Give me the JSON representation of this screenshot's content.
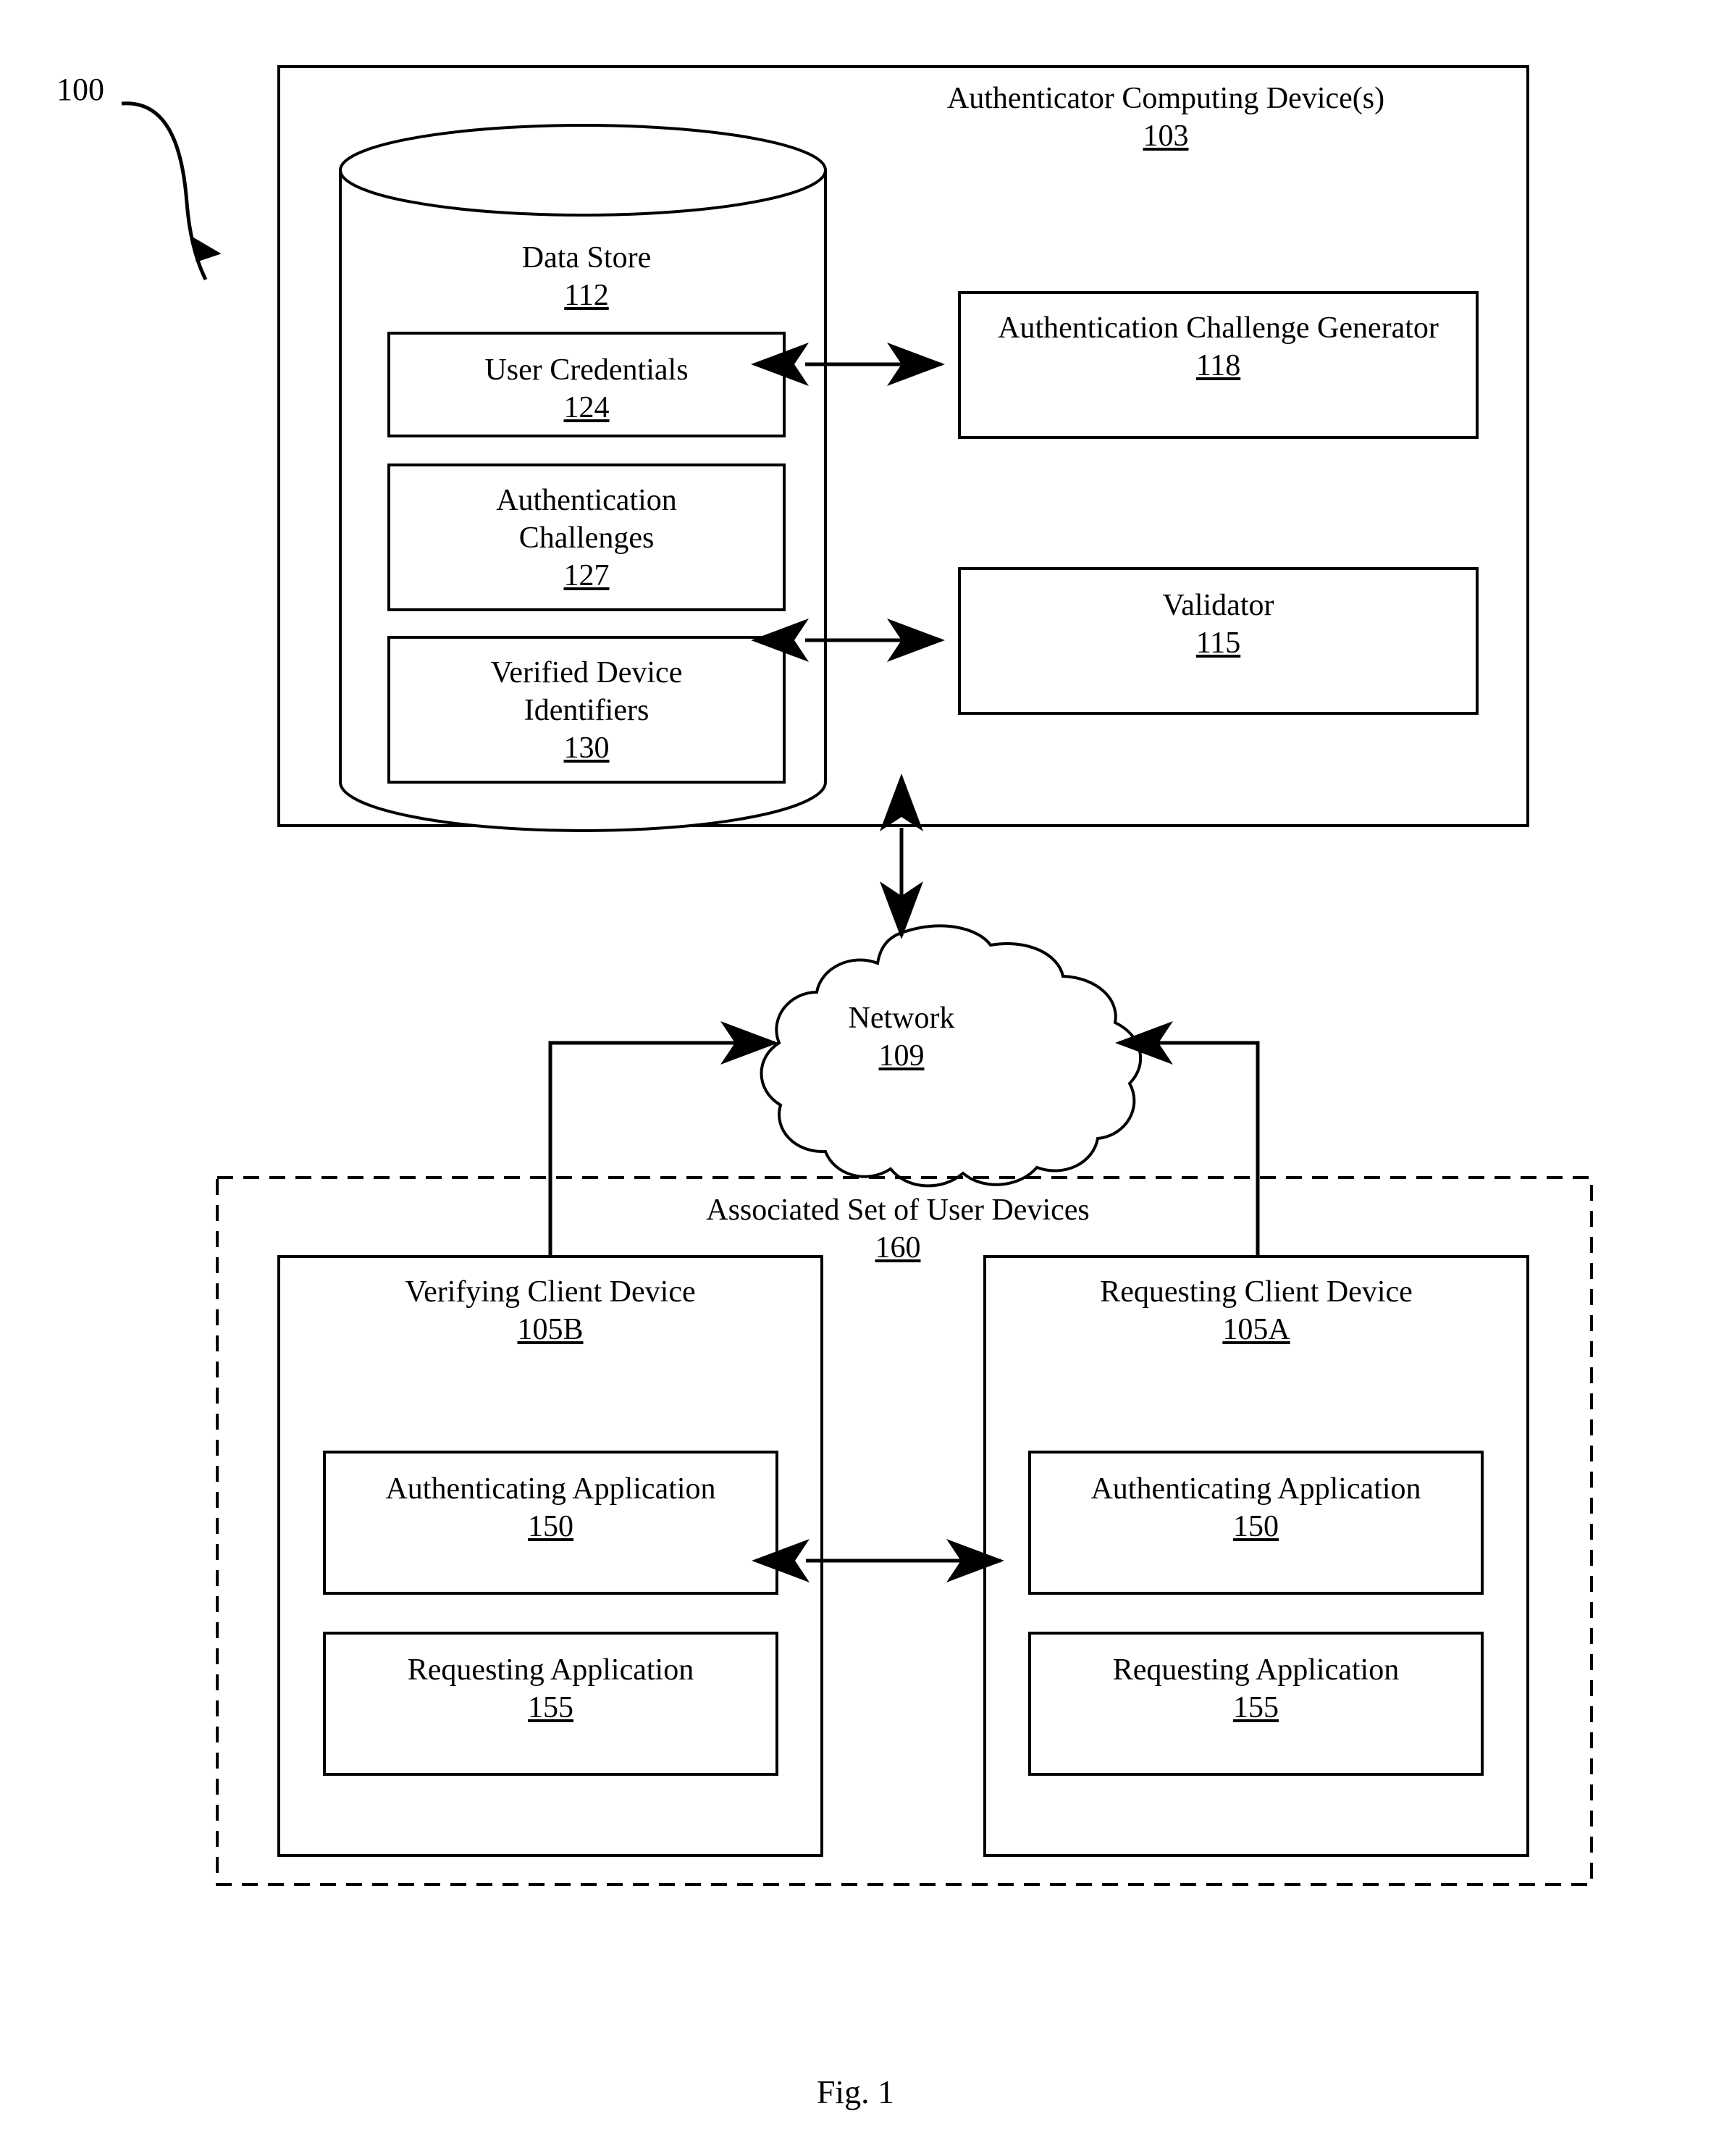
{
  "figure": {
    "caption": "Fig. 1",
    "system_ref": "100"
  },
  "authenticator": {
    "title": "Authenticator Computing Device(s)",
    "ref": "103",
    "data_store": {
      "title": "Data Store",
      "ref": "112",
      "items": [
        {
          "title": "User Credentials",
          "ref": "124"
        },
        {
          "title": "Authentication Challenges",
          "ref": "127"
        },
        {
          "title": "Verified Device Identifiers",
          "ref": "130"
        }
      ]
    },
    "modules": [
      {
        "title": "Authentication Challenge Generator",
        "ref": "118"
      },
      {
        "title": "Validator",
        "ref": "115"
      }
    ]
  },
  "network": {
    "title": "Network",
    "ref": "109"
  },
  "user_devices": {
    "title": "Associated Set of User Devices",
    "ref": "160",
    "devices": [
      {
        "title": "Verifying Client Device",
        "ref": "105B",
        "apps": [
          {
            "title": "Authenticating Application",
            "ref": "150"
          },
          {
            "title": "Requesting Application",
            "ref": "155"
          }
        ]
      },
      {
        "title": "Requesting Client Device",
        "ref": "105A",
        "apps": [
          {
            "title": "Authenticating Application",
            "ref": "150"
          },
          {
            "title": "Requesting Application",
            "ref": "155"
          }
        ]
      }
    ]
  },
  "colors": {
    "ink": "#000000",
    "paper": "#ffffff"
  }
}
